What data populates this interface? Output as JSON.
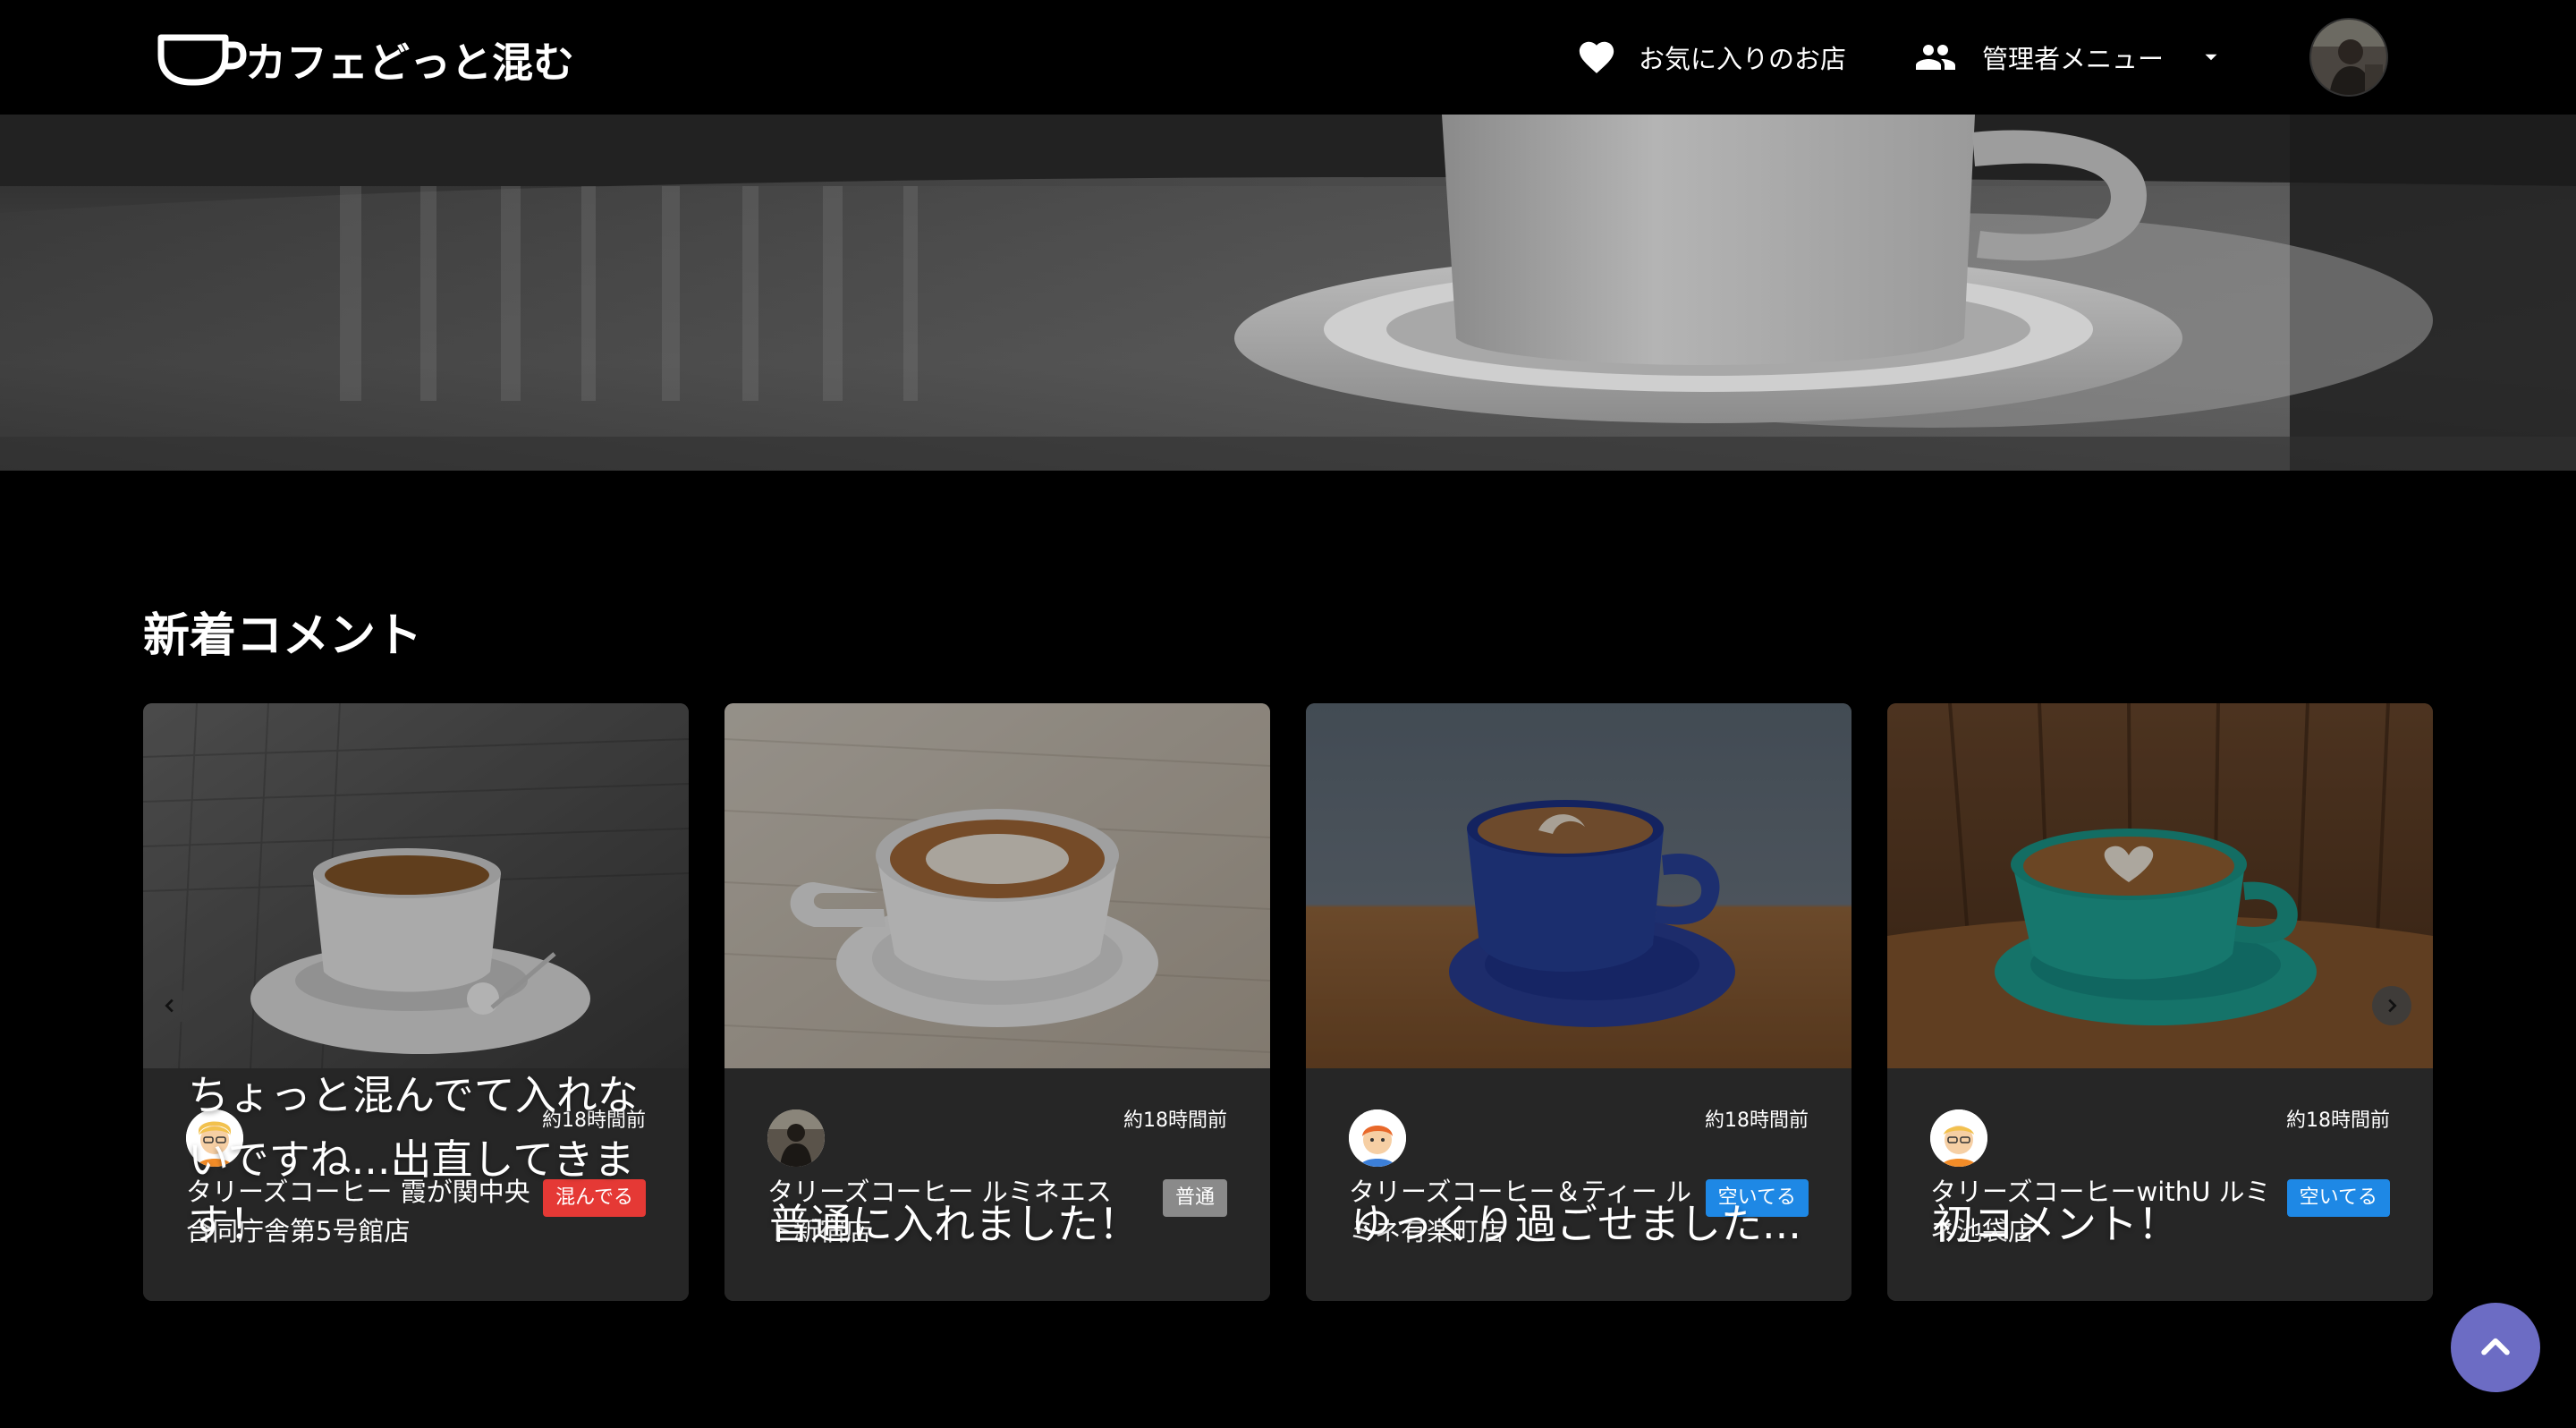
{
  "header": {
    "logo_text": "カフェどっと混む",
    "favorites_label": "お気に入りのお店",
    "admin_menu_label": "管理者メニュー"
  },
  "section": {
    "title": "新着コメント"
  },
  "cards": [
    {
      "comment": "ちょっと混んでて入れないですね...出直してきます！",
      "time": "約18時間前",
      "shop": "タリーズコーヒー 霞が関中央合同庁舎第5号館店",
      "status": "混んでる",
      "status_color": "#e53935"
    },
    {
      "comment": "普通に入れました！",
      "time": "約18時間前",
      "shop": "タリーズコーヒー ルミネエスト新宿店",
      "status": "普通",
      "status_color": "#8a8a8a"
    },
    {
      "comment": "ゆっくり過ごせました...",
      "time": "約18時間前",
      "shop": "タリーズコーヒー＆ティー ルミネ有楽町店",
      "status": "空いてる",
      "status_color": "#1e88e5"
    },
    {
      "comment": "初コメント！",
      "time": "約18時間前",
      "shop": "タリーズコーヒーwithU ルミネ池袋店",
      "status": "空いてる",
      "status_color": "#1e88e5"
    }
  ],
  "icons": {
    "favorites": "heart-icon",
    "admin": "people-icon",
    "dropdown": "caret-down-icon",
    "carousel_prev": "chevron-left-icon",
    "carousel_next": "chevron-right-icon",
    "scroll_top": "chevron-up-icon"
  },
  "colors": {
    "background": "#000000",
    "card_body": "#262626",
    "scroll_top_button": "#6c6cc4"
  }
}
